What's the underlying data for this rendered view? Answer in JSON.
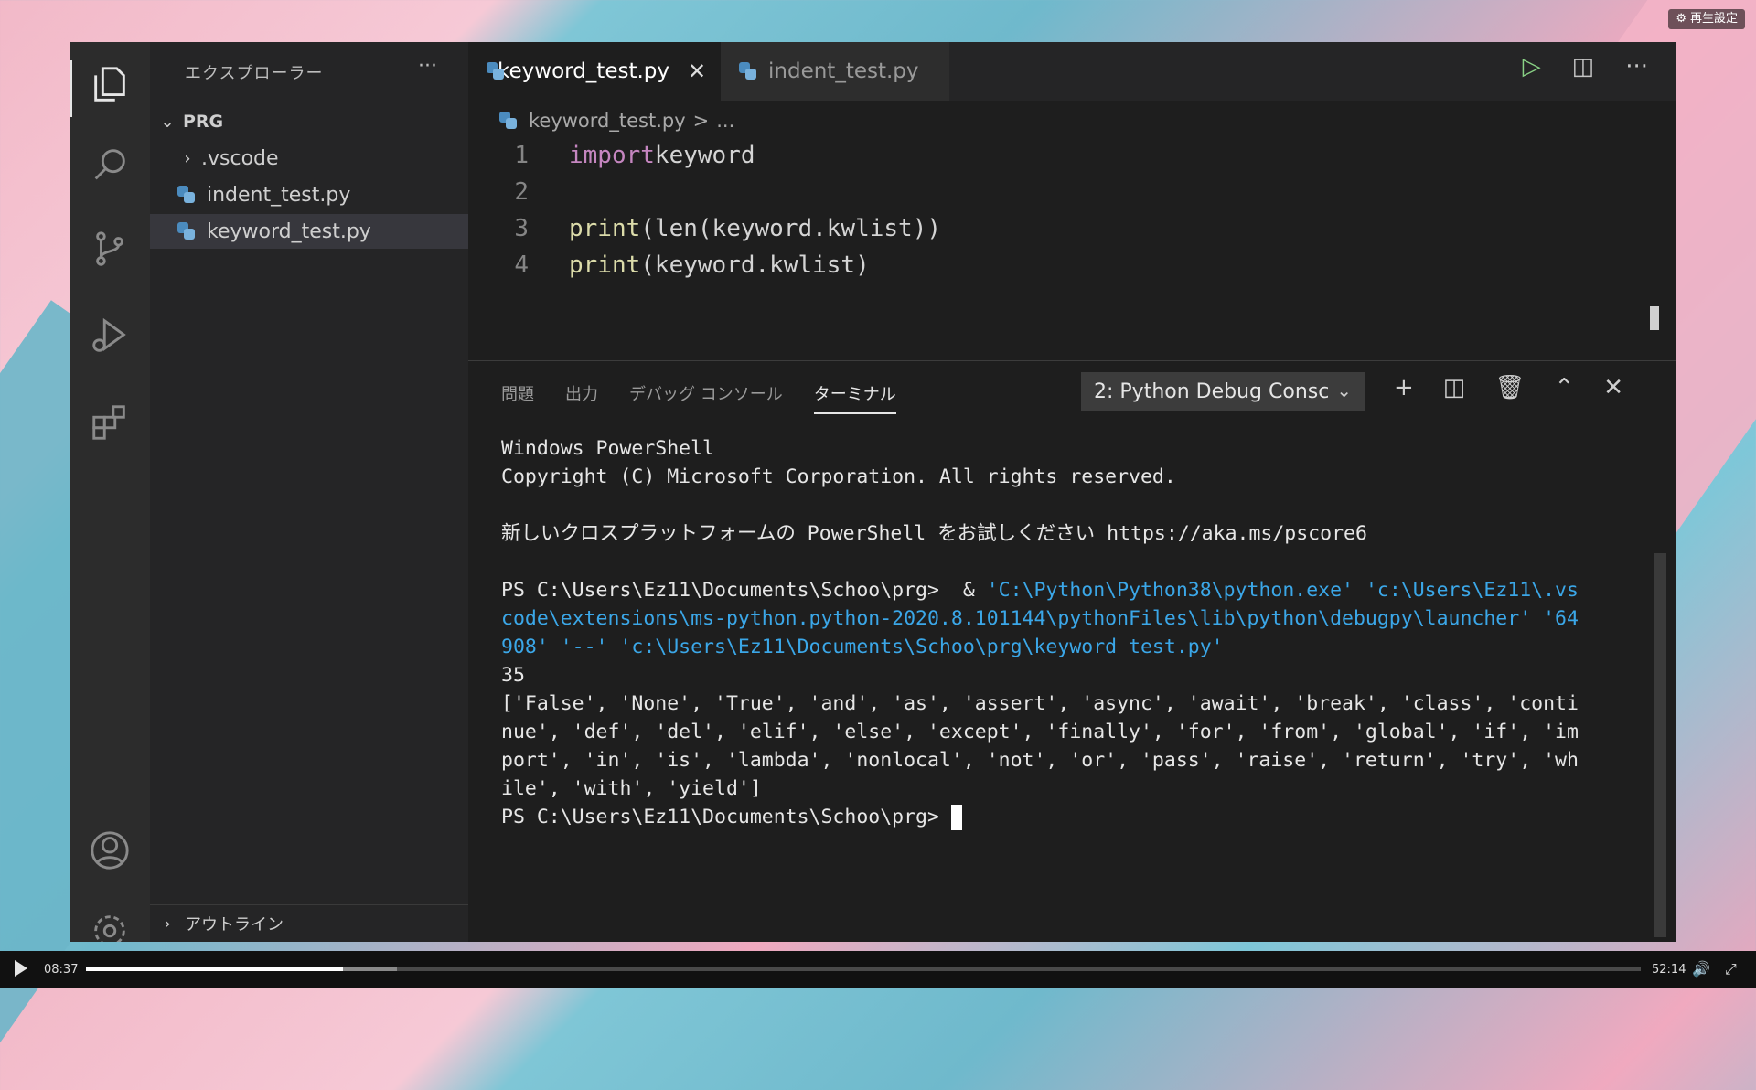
{
  "overlay": {
    "replay_settings": "再生設定"
  },
  "sidebar": {
    "title": "エクスプローラー",
    "more": "···",
    "folder": "PRG",
    "items": [
      {
        "label": ".vscode"
      },
      {
        "label": "indent_test.py"
      },
      {
        "label": "keyword_test.py"
      }
    ],
    "outline": "アウトライン"
  },
  "tabs": [
    {
      "label": "keyword_test.py",
      "close": "✕"
    },
    {
      "label": "indent_test.py"
    }
  ],
  "breadcrumb": {
    "file": "keyword_test.py",
    "sep": ">",
    "rest": "..."
  },
  "code": {
    "lines": [
      {
        "n": "1",
        "kw": "import",
        "rest": " keyword"
      },
      {
        "n": "2",
        "text": ""
      },
      {
        "n": "3",
        "fn": "print",
        "rest": "(len(keyword.kwlist))"
      },
      {
        "n": "4",
        "fn": "print",
        "rest": "(keyword.kwlist)"
      }
    ]
  },
  "panel": {
    "tabs": [
      "問題",
      "出力",
      "デバッグ コンソール",
      "ターミナル"
    ],
    "terminal_select": "2: Python Debug Consc"
  },
  "terminal": {
    "l1": "Windows PowerShell",
    "l2": "Copyright (C) Microsoft Corporation. All rights reserved.",
    "l3": "新しいクロスプラットフォームの PowerShell をお試しください https://aka.ms/pscore6",
    "prompt": "PS C:\\Users\\Ez11\\Documents\\Schoo\\prg> ",
    "amp": " & ",
    "cmd1": "'C:\\Python\\Python38\\python.exe' 'c:\\Users\\Ez11\\.vs",
    "cmd2": "code\\extensions\\ms-python.python-2020.8.101144\\pythonFiles\\lib\\python\\debugpy\\launcher' '64",
    "cmd3": "908' '--' 'c:\\Users\\Ez11\\Documents\\Schoo\\prg\\keyword_test.py'",
    "out1": "35",
    "out2": "['False', 'None', 'True', 'and', 'as', 'assert', 'async', 'await', 'break', 'class', 'conti",
    "out3": "nue', 'def', 'del', 'elif', 'else', 'except', 'finally', 'for', 'from', 'global', 'if', 'im",
    "out4": "port', 'in', 'is', 'lambda', 'nonlocal', 'not', 'or', 'pass', 'raise', 'return', 'try', 'wh",
    "out5": "ile', 'with', 'yield']",
    "prompt2": "PS C:\\Users\\Ez11\\Documents\\Schoo\\prg> "
  },
  "video": {
    "current": "08:37",
    "total": "52:14",
    "progress_fraction": 0.165,
    "buffered_fraction": 0.2
  }
}
